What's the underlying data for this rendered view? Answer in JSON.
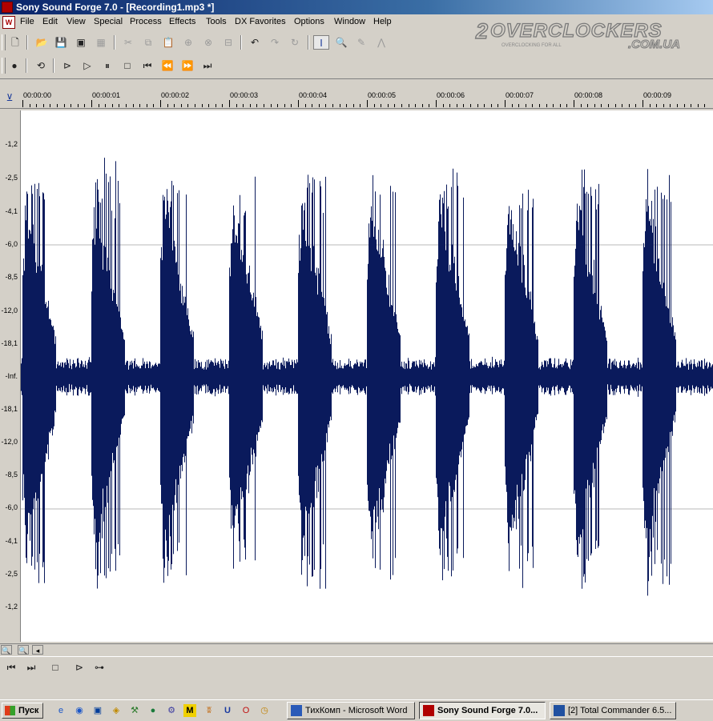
{
  "window": {
    "title": "Sony Sound Forge 7.0 - [Recording1.mp3 *]"
  },
  "menu": [
    "File",
    "Edit",
    "View",
    "Special",
    "Process",
    "Effects",
    "Tools",
    "DX Favorites",
    "Options",
    "Window",
    "Help"
  ],
  "watermark": {
    "main": "OVERCLOCKERS",
    "sub": ".COM.UA",
    "tag": "OVERCLOCKING FOR ALL"
  },
  "ruler": {
    "ticks": [
      "00:00:00",
      "00:00:01",
      "00:00:02",
      "00:00:03",
      "00:00:04",
      "00:00:05",
      "00:00:06",
      "00:00:07",
      "00:00:08",
      "00:00:09"
    ]
  },
  "scale": {
    "labels": [
      "-1,2",
      "-2,5",
      "-4,1",
      "-6,0",
      "-8,5",
      "-12,0",
      "-18,1",
      "-Inf.",
      "-18,1",
      "-12,0",
      "-8,5",
      "-6,0",
      "-4,1",
      "-2,5",
      "-1,2"
    ]
  },
  "waveform": {
    "color": "#0a1a5c",
    "beats": 10
  },
  "taskbar": {
    "start_label": "Пуск",
    "tasks": [
      {
        "label": "ТихКомп - Microsoft Word",
        "active": false
      },
      {
        "label": "Sony Sound Forge 7.0...",
        "active": true
      },
      {
        "label": "[2] Total Commander 6.5...",
        "active": false
      }
    ]
  }
}
